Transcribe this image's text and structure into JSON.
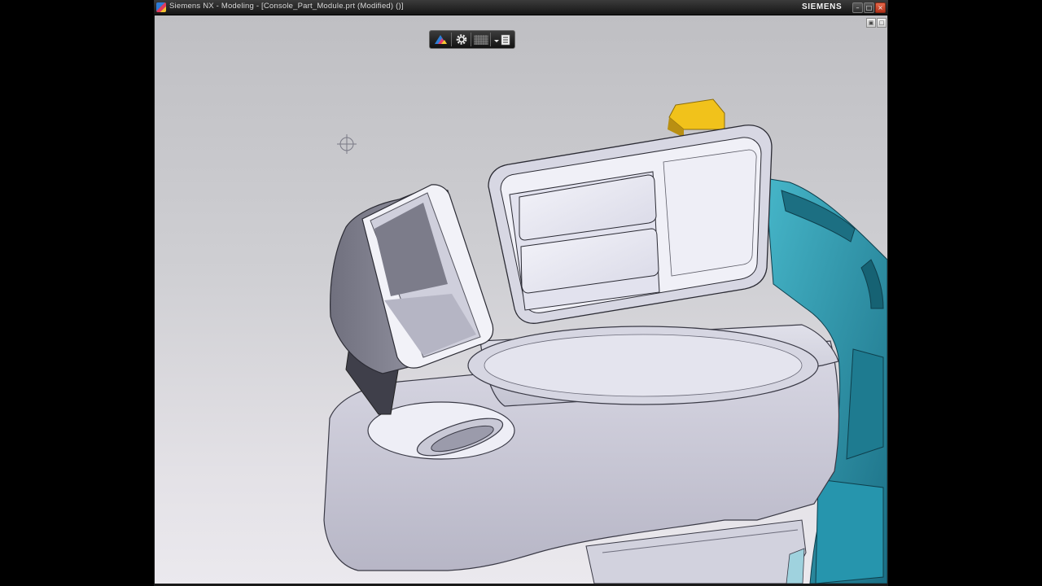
{
  "window": {
    "title": "Siemens NX - Modeling - [Console_Part_Module.prt (Modified)    ()]",
    "brand": "SIEMENS",
    "buttons": {
      "minimize": "–",
      "maximize": "□",
      "close": "×"
    }
  },
  "viewport": {
    "sub_buttons": {
      "restore": "▣",
      "maximize": "□"
    },
    "toolbar": {
      "items": [
        "render-style-icon",
        "gear-icon",
        "grid-icon",
        "menu-list-icon"
      ]
    },
    "model": {
      "body_color": "#c7c6d4",
      "teal_color": "#2a8fa6",
      "yellow_color": "#f1c21b"
    }
  }
}
